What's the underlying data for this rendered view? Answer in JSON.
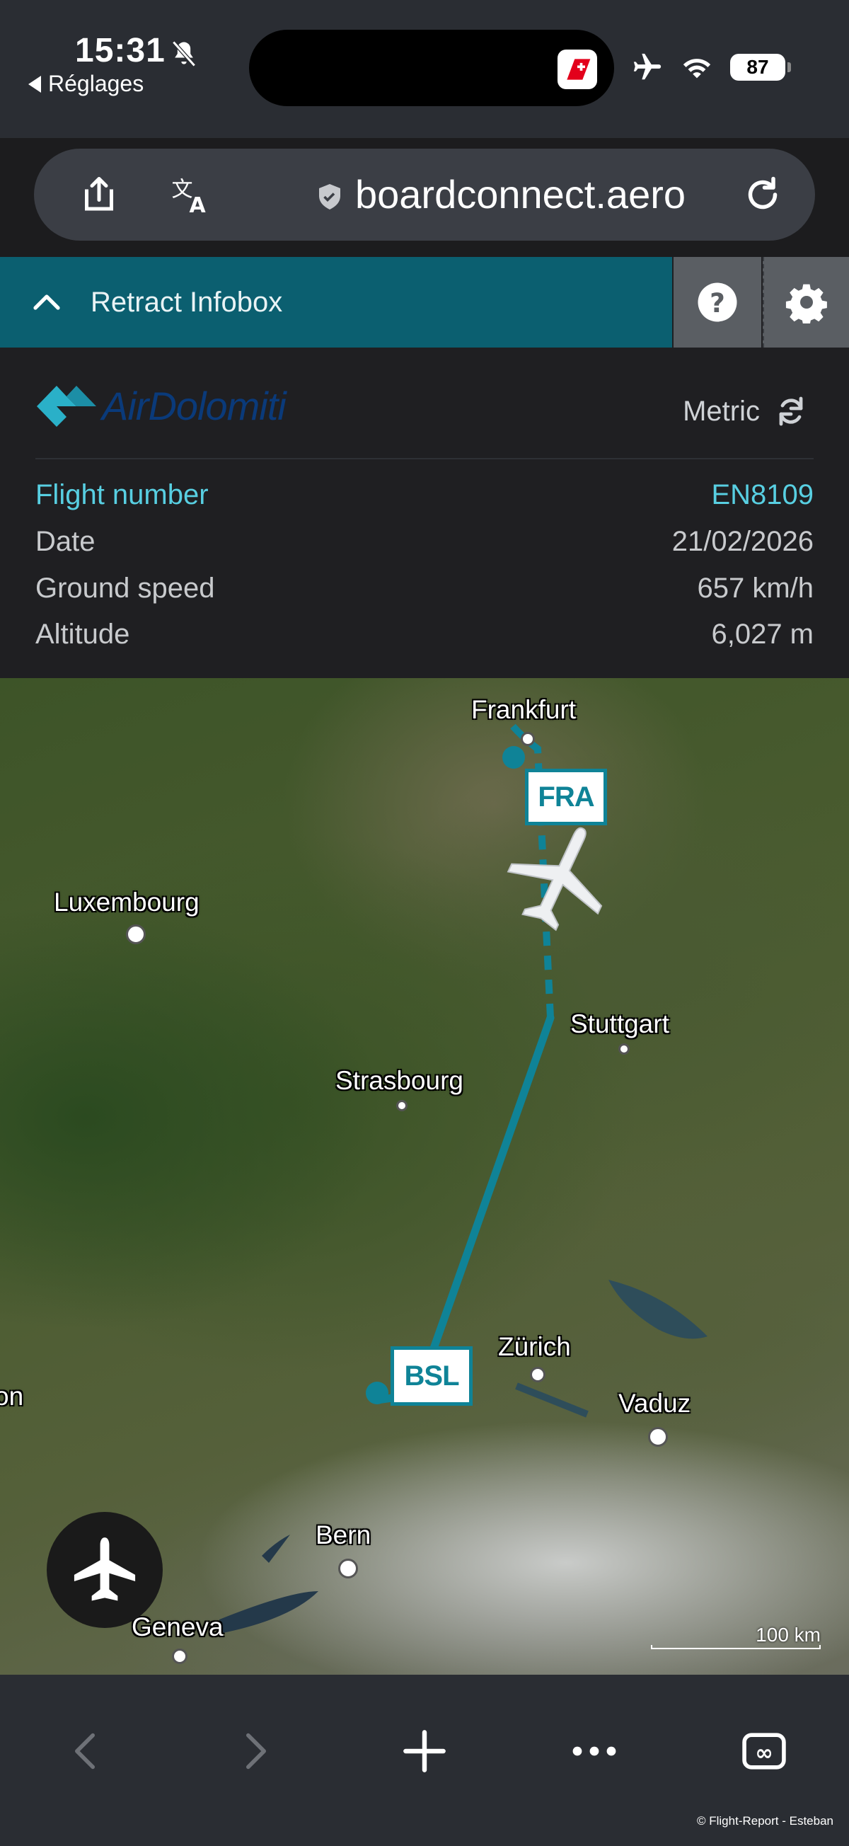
{
  "status_bar": {
    "time": "15:31",
    "back_app": "Réglages",
    "battery": "87"
  },
  "browser": {
    "url": "boardconnect.aero"
  },
  "infobox": {
    "retract_label": "Retract Infobox",
    "airline_logo": "AirDolomiti",
    "unit_system": "Metric",
    "rows": [
      {
        "label": "Flight number",
        "value": "EN8109"
      },
      {
        "label": "Date",
        "value": "21/02/2026"
      },
      {
        "label": "Ground speed",
        "value": "657 km/h"
      },
      {
        "label": "Altitude",
        "value": "6,027 m"
      }
    ]
  },
  "map": {
    "cities": {
      "frankfurt": "Frankfurt",
      "luxembourg": "Luxembourg",
      "stuttgart": "Stuttgart",
      "strasbourg": "Strasbourg",
      "zurich": "Zürich",
      "vaduz": "Vaduz",
      "bern": "Bern",
      "geneva": "Geneva",
      "edge": "on"
    },
    "origin": "BSL",
    "destination": "FRA",
    "scale": "100 km",
    "route_color": "#0f8397"
  },
  "credit": "© Flight-Report - Esteban",
  "colors": {
    "accent": "#58cfe2",
    "header_teal": "#0b5f70"
  },
  "icons": [
    "bell-slash-icon",
    "airplane-mode-icon",
    "wifi-icon",
    "share-icon",
    "translate-icon",
    "shield-icon",
    "reload-icon",
    "chevron-up-icon",
    "help-icon",
    "gear-icon",
    "refresh-icon",
    "plane-icon",
    "back-icon",
    "forward-icon",
    "plus-icon",
    "more-icon",
    "tabs-icon"
  ]
}
